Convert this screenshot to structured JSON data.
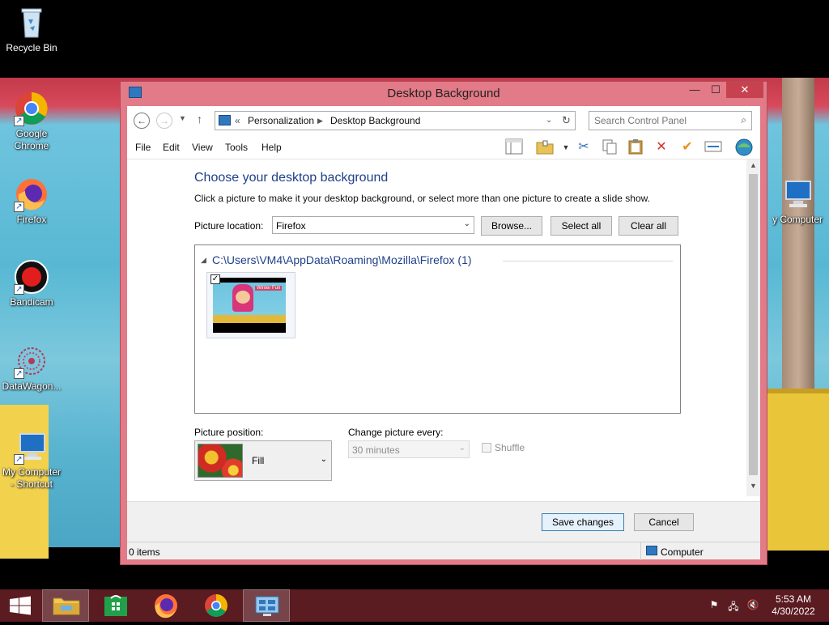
{
  "desktop": {
    "icons": [
      {
        "label": "Recycle Bin"
      },
      {
        "label": "Google Chrome"
      },
      {
        "label": "Firefox"
      },
      {
        "label": "Bandicam"
      },
      {
        "label": "DataWagon..."
      },
      {
        "label": "My Computer - Shortcut"
      },
      {
        "label": "y Computer"
      }
    ]
  },
  "window": {
    "title": "Desktop Background",
    "controls": {
      "minimize": "—",
      "maximize": "☐",
      "close": "✕"
    }
  },
  "address": {
    "overflow": "«",
    "crumbs": [
      "Personalization",
      "Desktop Background"
    ],
    "search_placeholder": "Search Control Panel"
  },
  "menu": [
    "File",
    "Edit",
    "View",
    "Tools",
    "Help"
  ],
  "toolbar_icons": [
    "layout-icon",
    "folder-icon",
    "cut-icon",
    "copy-icon",
    "paste-icon",
    "delete-icon",
    "check-icon",
    "properties-icon",
    "globe-icon"
  ],
  "main": {
    "heading": "Choose your desktop background",
    "subtext": "Click a picture to make it your desktop background, or select more than one picture to create a slide show.",
    "picture_location_label": "Picture location:",
    "picture_location_value": "Firefox",
    "browse_label": "Browse...",
    "select_all_label": "Select all",
    "clear_all_label": "Clear all",
    "folder_path": "C:\\Users\\VM4\\AppData\\Roaming\\Mozilla\\Firefox (1)",
    "thumbnail_caption": "Winter Fun",
    "thumbnail_checked": true,
    "picture_position_label": "Picture position:",
    "picture_position_value": "Fill",
    "change_every_label": "Change picture every:",
    "change_every_value": "30 minutes",
    "shuffle_label": "Shuffle",
    "shuffle_checked": false
  },
  "footer": {
    "save_label": "Save changes",
    "cancel_label": "Cancel"
  },
  "status": {
    "items": "0 items",
    "location": "Computer"
  },
  "taskbar": {
    "time": "5:53 AM",
    "date": "4/30/2022"
  },
  "colors": {
    "window_frame": "#e27a87",
    "close_button": "#c7424f",
    "heading_text": "#1e3f8a",
    "taskbar": "#5a1b21"
  }
}
